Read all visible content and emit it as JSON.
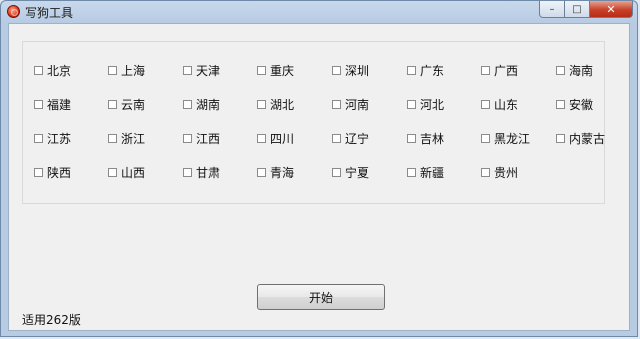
{
  "window": {
    "title": "写狗工具"
  },
  "controls": {
    "minimize": "–",
    "maximize": "□",
    "close": "✕"
  },
  "provinces": [
    [
      "北京",
      "上海",
      "天津",
      "重庆",
      "深圳",
      "广东",
      "广西",
      "海南"
    ],
    [
      "福建",
      "云南",
      "湖南",
      "湖北",
      "河南",
      "河北",
      "山东",
      "安徽"
    ],
    [
      "江苏",
      "浙江",
      "江西",
      "四川",
      "辽宁",
      "吉林",
      "黑龙江",
      "内蒙古"
    ],
    [
      "陕西",
      "山西",
      "甘肃",
      "青海",
      "宁夏",
      "新疆",
      "贵州"
    ]
  ],
  "start_button": "开始",
  "status_text": "适用262版"
}
